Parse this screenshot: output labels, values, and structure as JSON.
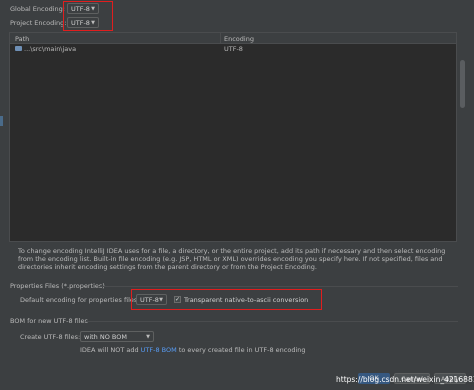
{
  "global_encoding": {
    "label": "Global Encoding:",
    "value": "UTF-8"
  },
  "project_encoding": {
    "label": "Project Encoding:",
    "value": "UTF-8"
  },
  "table": {
    "columns": [
      "Path",
      "Encoding"
    ],
    "rows": [
      {
        "path": "...\\src\\main\\java",
        "encoding": "UTF-8"
      }
    ]
  },
  "help_text": "To change encoding IntelliJ IDEA uses for a file, a directory, or the entire project, add its path if necessary and then select encoding from the encoding list. Built-in file encoding (e.g. JSP, HTML or XML) overrides encoding you specify here. If not specified, files and directories inherit encoding settings from the parent directory or from the Project Encoding.",
  "properties": {
    "section_title": "Properties Files (*.properties)",
    "default_label": "Default encoding for properties files:",
    "default_value": "UTF-8",
    "native_to_ascii_label": "Transparent native-to-ascii conversion",
    "native_to_ascii_checked": "✓"
  },
  "bom": {
    "section_title": "BOM for new UTF-8 files",
    "create_label": "Create UTF-8 files:",
    "create_value": "with NO BOM",
    "note_prefix": "IDEA will NOT add",
    "note_link": "UTF-8 BOM",
    "note_suffix": "to every created file in UTF-8 encoding"
  },
  "buttons": {
    "ok": "OK",
    "cancel": "Cancel",
    "apply": "Apply"
  },
  "watermark": "https://blog.csdn.net/weixin_42168816",
  "colors": {
    "accent_red": "#e01e1e",
    "link_blue": "#589df6",
    "background": "#3c3f41",
    "table_bg": "#2b2b2b"
  }
}
